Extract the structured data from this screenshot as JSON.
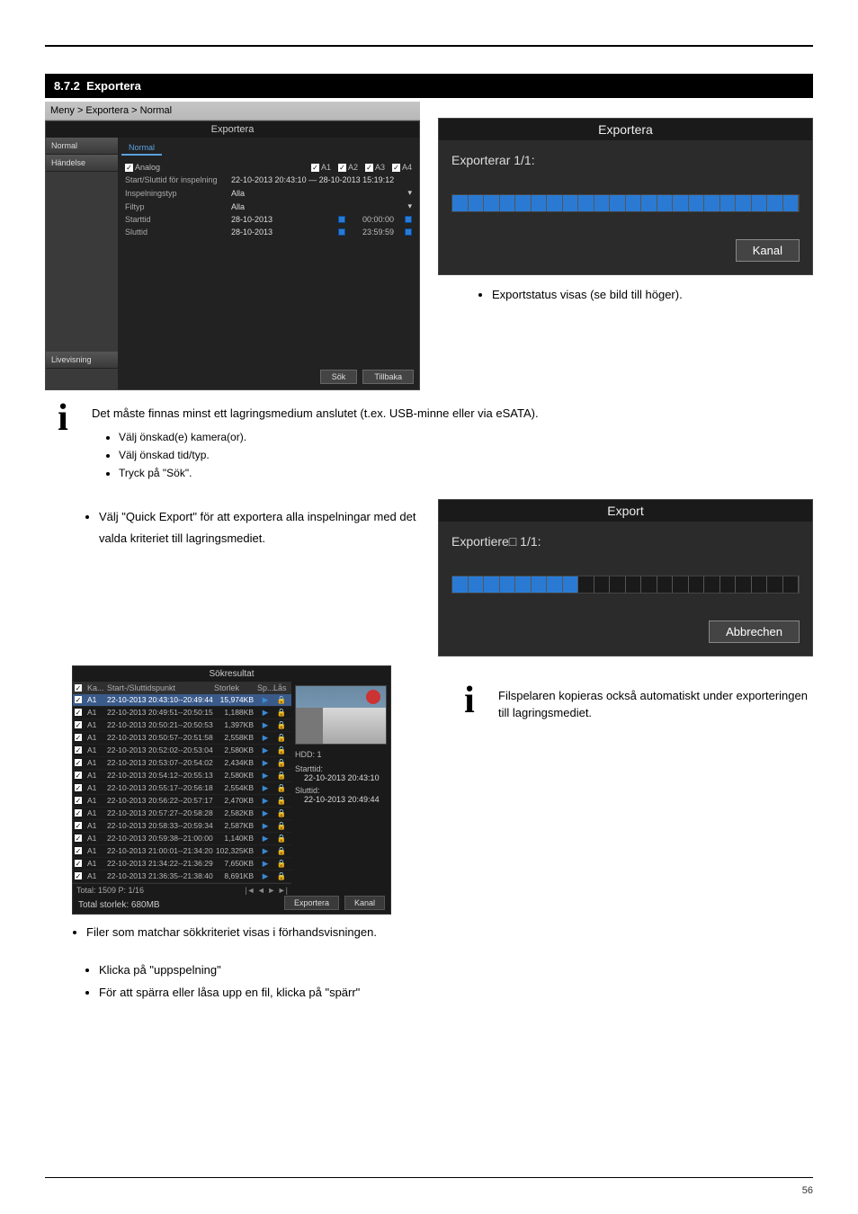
{
  "page_number": "56",
  "section": {
    "number": "8.7.2",
    "title": "Exportera"
  },
  "nav_text": "Meny > Exportera > Normal",
  "export_screen": {
    "title": "Exportera",
    "sidebar": [
      "Normal",
      "Händelse",
      "Livevisning"
    ],
    "tab": "Normal",
    "analog_label": "Analog",
    "channels": [
      "A1",
      "A2",
      "A3",
      "A4"
    ],
    "rows": {
      "r1_label": "Start/Sluttid för inspelning",
      "r1_val": "22-10-2013 20:43:10 — 28-10-2013 15:19:12",
      "r2_label": "Inspelningstyp",
      "r2_val": "Alla",
      "r3_label": "Filtyp",
      "r3_val": "Alla",
      "r4_label": "Starttid",
      "r4_date": "28-10-2013",
      "r4_time": "00:00:00",
      "r5_label": "Sluttid",
      "r5_date": "28-10-2013",
      "r5_time": "23:59:59"
    },
    "buttons": {
      "search": "Sök",
      "back": "Tillbaka"
    }
  },
  "dialog_right_top": {
    "title": "Exportera",
    "status": "Exporterar 1/1:",
    "button": "Kanal"
  },
  "dialog_right_bottom": {
    "title": "Export",
    "status": "Exportiere□ 1/1:",
    "button": "Abbrechen"
  },
  "info1": {
    "body": "Det måste finnas minst ett lagringsmedium anslutet (t.ex. USB-minne eller via eSATA)."
  },
  "bullets_info1": [
    "Välj önskad(e) kamera(or).",
    "Välj önskad tid/typ.",
    "Tryck på \"Sök\"."
  ],
  "bullet_before_results": "Välj \"Quick Export\" för att exportera alla inspelningar med det valda kriteriet till lagringsmediet.",
  "bullet_after_dialog_top": "Exportstatus visas (se bild till höger).",
  "info2": {
    "body": "Filspelaren kopieras också automatiskt under exporteringen till lagringsmediet."
  },
  "bullet_search_preview": "Filer som matchar sökkriteriet visas i förhandsvisningen.",
  "bullets_bottom": [
    "Klicka på \"uppspelning\"",
    "För att spärra eller låsa upp en fil, klicka på \"spärr\""
  ],
  "results": {
    "title": "Sökresultat",
    "head": {
      "c1": "",
      "c2": "Ka...",
      "c3": "Start-/Sluttidspunkt",
      "c4": "Storlek",
      "c5": "Sp...",
      "c6": "Lås"
    },
    "rows": [
      {
        "ch": "A1",
        "time": "22-10-2013 20:43:10--20:49:44",
        "size": "15,974KB",
        "sel": true
      },
      {
        "ch": "A1",
        "time": "22-10-2013 20:49:51--20:50:15",
        "size": "1,188KB"
      },
      {
        "ch": "A1",
        "time": "22-10-2013 20:50:21--20:50:53",
        "size": "1,397KB"
      },
      {
        "ch": "A1",
        "time": "22-10-2013 20:50:57--20:51:58",
        "size": "2,558KB"
      },
      {
        "ch": "A1",
        "time": "22-10-2013 20:52:02--20:53:04",
        "size": "2,580KB"
      },
      {
        "ch": "A1",
        "time": "22-10-2013 20:53:07--20:54:02",
        "size": "2,434KB"
      },
      {
        "ch": "A1",
        "time": "22-10-2013 20:54:12--20:55:13",
        "size": "2,580KB"
      },
      {
        "ch": "A1",
        "time": "22-10-2013 20:55:17--20:56:18",
        "size": "2,554KB"
      },
      {
        "ch": "A1",
        "time": "22-10-2013 20:56:22--20:57:17",
        "size": "2,470KB"
      },
      {
        "ch": "A1",
        "time": "22-10-2013 20:57:27--20:58:28",
        "size": "2,582KB"
      },
      {
        "ch": "A1",
        "time": "22-10-2013 20:58:33--20:59:34",
        "size": "2,587KB"
      },
      {
        "ch": "A1",
        "time": "22-10-2013 20:59:38--21:00:00",
        "size": "1,140KB"
      },
      {
        "ch": "A1",
        "time": "22-10-2013 21:00:01--21:34:20",
        "size": "102,325KB"
      },
      {
        "ch": "A1",
        "time": "22-10-2013 21:34:22--21:36:29",
        "size": "7,650KB"
      },
      {
        "ch": "A1",
        "time": "22-10-2013 21:36:35--21:38:40",
        "size": "8,691KB"
      }
    ],
    "footer": "Total: 1509  P: 1/16",
    "total_size": "Total storlek: 680MB",
    "preview": {
      "hdd": "HDD: 1",
      "start_label": "Starttid:",
      "start_val": "22-10-2013 20:43:10",
      "end_label": "Sluttid:",
      "end_val": "22-10-2013 20:49:44"
    },
    "buttons": {
      "export": "Exportera",
      "cancel": "Kanal"
    }
  }
}
